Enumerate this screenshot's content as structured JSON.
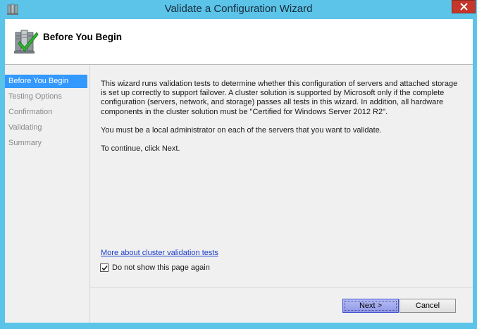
{
  "window": {
    "title": "Validate a Configuration Wizard"
  },
  "header": {
    "title": "Before You Begin"
  },
  "nav": {
    "items": [
      {
        "label": "Before You Begin",
        "active": true
      },
      {
        "label": "Testing Options",
        "active": false
      },
      {
        "label": "Confirmation",
        "active": false
      },
      {
        "label": "Validating",
        "active": false
      },
      {
        "label": "Summary",
        "active": false
      }
    ]
  },
  "content": {
    "paragraph1": "This wizard runs validation tests to determine whether this configuration of servers and attached storage is set up correctly to support failover. A cluster solution is supported by Microsoft only if the complete configuration (servers, network, and storage) passes all tests in this wizard. In addition, all hardware components in the cluster solution must be \"Certified for Windows Server 2012 R2\".",
    "paragraph2": "You must be a local administrator on each of the servers that you want to validate.",
    "paragraph3": "To continue, click Next.",
    "more_link": "More about cluster validation tests",
    "checkbox_label": "Do not show this page again",
    "checkbox_checked": true
  },
  "buttons": {
    "next": "Next >",
    "cancel": "Cancel"
  },
  "colors": {
    "frame": "#5bc4e8",
    "nav_active": "#3399ff",
    "close": "#c7362b",
    "link": "#1a3dc8"
  }
}
